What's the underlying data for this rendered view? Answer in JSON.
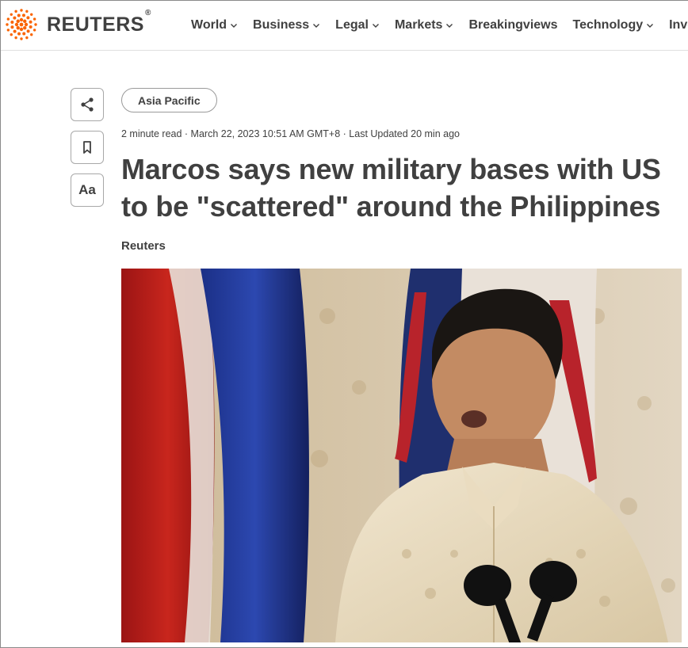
{
  "brand": {
    "name": "REUTERS",
    "registered": "®",
    "accent_color": "#fa6400",
    "logo_icon": "reuters-dot-ring-logo"
  },
  "nav": {
    "items": [
      {
        "label": "World",
        "has_dropdown": true
      },
      {
        "label": "Business",
        "has_dropdown": true
      },
      {
        "label": "Legal",
        "has_dropdown": true
      },
      {
        "label": "Markets",
        "has_dropdown": true
      },
      {
        "label": "Breakingviews",
        "has_dropdown": false
      },
      {
        "label": "Technology",
        "has_dropdown": true
      },
      {
        "label": "Investiga",
        "has_dropdown": false
      }
    ]
  },
  "actions": {
    "share_icon": "share-icon",
    "bookmark_icon": "bookmark-icon",
    "font_size_label": "Aa"
  },
  "article": {
    "section_tag": "Asia Pacific",
    "meta": "2 minute read · March 22, 2023 10:51 AM GMT+8 · Last Updated 20 min ago",
    "headline": "Marcos says new military bases with US to be \"scattered\" around the Philippines",
    "byline": "Reuters"
  },
  "colors": {
    "text": "#404040",
    "border": "#e0e0e0"
  }
}
